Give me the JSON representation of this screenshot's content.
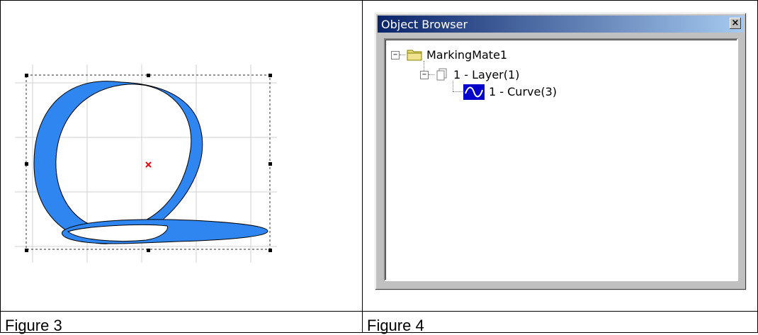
{
  "figure3": {
    "caption": "Figure 3"
  },
  "figure4": {
    "caption": "Figure 4",
    "window": {
      "title": "Object Browser",
      "close_symbol": "×"
    },
    "tree": {
      "root": {
        "label": "MarkingMate1",
        "icon": "folder-icon",
        "toggle": "−"
      },
      "layer": {
        "label": "1 - Layer(1)",
        "icon": "page-icon",
        "toggle": "−"
      },
      "curve": {
        "label": "1 - Curve(3)",
        "icon": "curve-icon"
      }
    }
  },
  "colors": {
    "shape_fill": "#2f86f0",
    "center_marker": "#e01010",
    "title_bar": "#0a246a",
    "folder": "#e8d878",
    "selection": "#0000cc"
  }
}
